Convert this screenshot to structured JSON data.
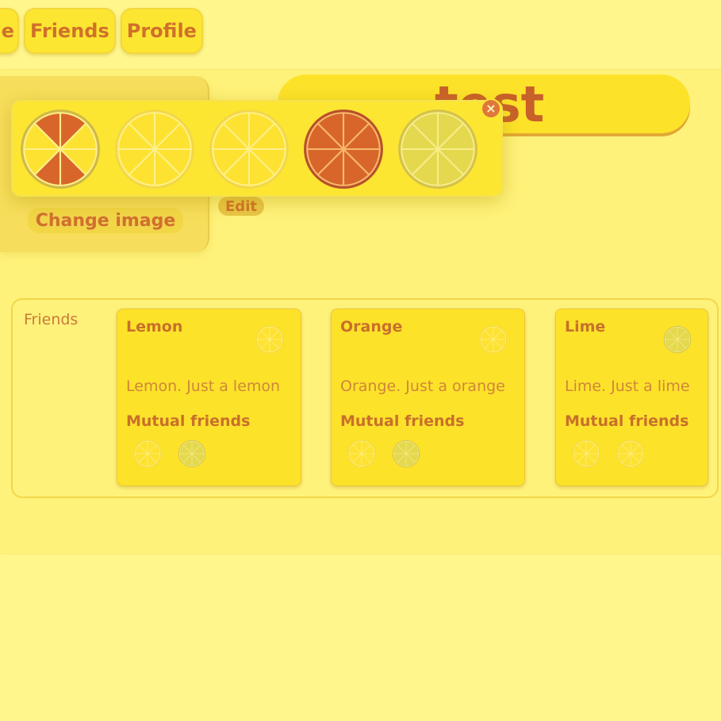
{
  "nav": {
    "tabs": [
      {
        "label": "e",
        "partial": true
      },
      {
        "label": "Friends"
      },
      {
        "label": "Profile"
      }
    ]
  },
  "profile": {
    "name": "test",
    "change_image_label": "Change image",
    "edit_label": "Edit",
    "avatar_options": [
      "lemon-orange-split-icon",
      "lemon-icon",
      "lemon-icon",
      "orange-icon",
      "lime-icon"
    ],
    "close_symbol": "×"
  },
  "friends": {
    "section_label": "Friends",
    "cards": [
      {
        "name": "Lemon",
        "description": "Lemon. Just a lemon",
        "mutual_label": "Mutual friends",
        "avatar": "lemon-icon",
        "mutual": [
          "lemon-icon",
          "lime-icon"
        ]
      },
      {
        "name": "Orange",
        "description": "Orange. Just a orange",
        "mutual_label": "Mutual friends",
        "avatar": "lemon-icon",
        "mutual": [
          "lemon-icon",
          "lime-icon"
        ]
      },
      {
        "name": "Lime",
        "description": "Lime. Just a lime",
        "mutual_label": "Mutual friends",
        "avatar": "lime-icon",
        "mutual": [
          "lemon-icon",
          "lemon-icon"
        ]
      }
    ]
  },
  "colors": {
    "background": "#fff68c",
    "accent_text": "#c8702a",
    "lemon": "#fde232",
    "orange": "#d8662a",
    "lime": "#e4d84e"
  }
}
